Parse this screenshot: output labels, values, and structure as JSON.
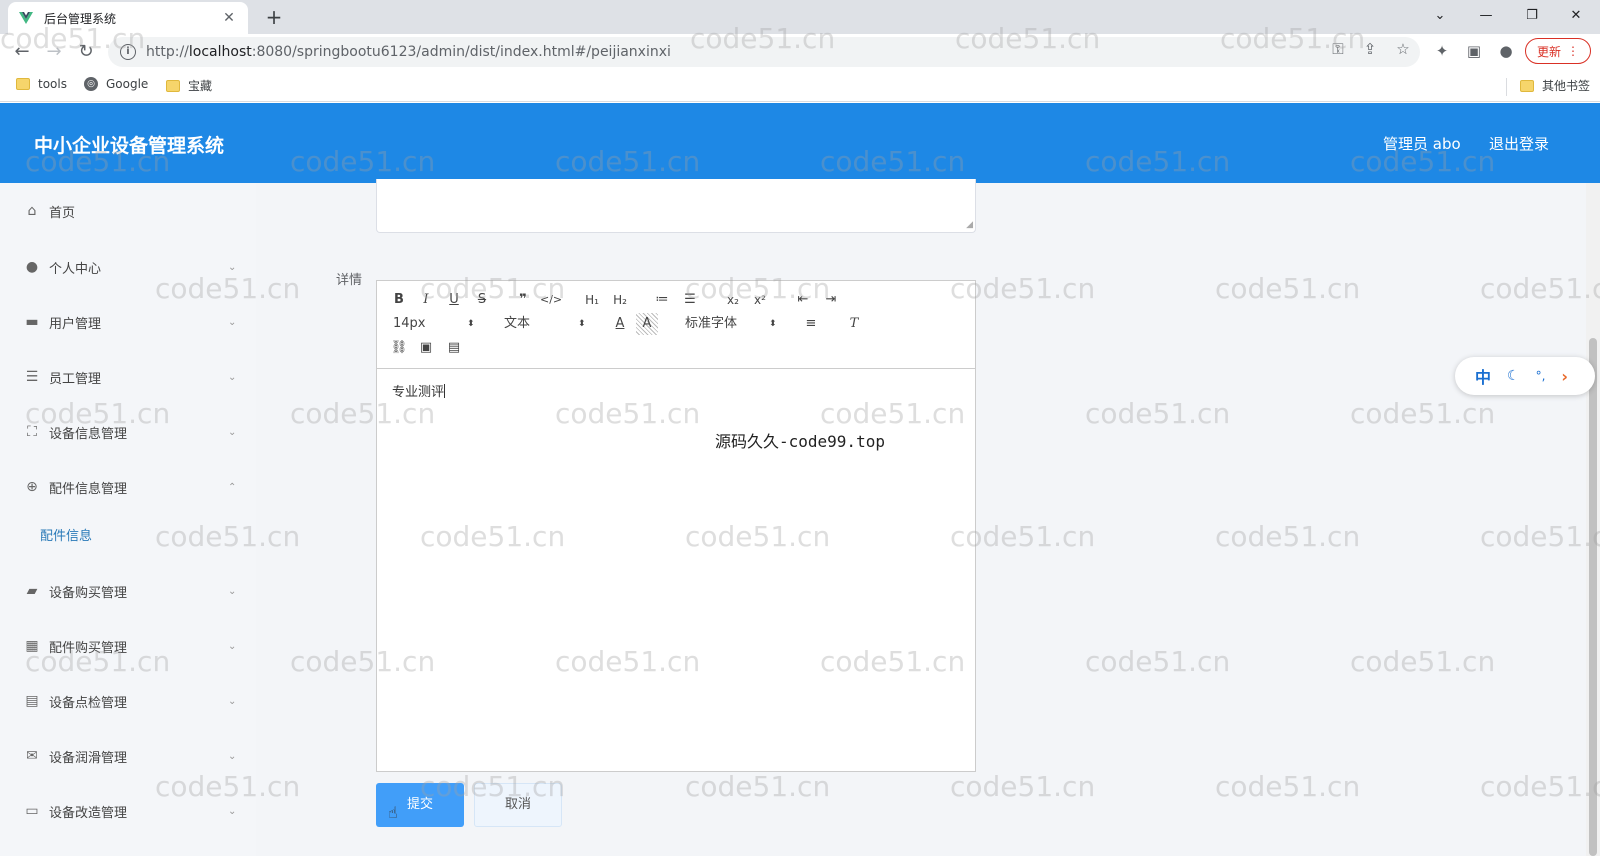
{
  "browser": {
    "tab_title": "后台管理系统",
    "tab_close": "✕",
    "new_tab": "+",
    "url_prefix": "http://",
    "url_host": "localhost",
    "url_rest": ":8080/springbootu6123/admin/dist/index.html#/peijianxinxi",
    "update_label": "更新",
    "bookmarks": [
      "tools",
      "Google",
      "宝藏"
    ],
    "other_bookmarks": "其他书签"
  },
  "app": {
    "title": "中小企业设备管理系统",
    "user": "管理员 abo",
    "logout": "退出登录"
  },
  "sidebar": {
    "items": [
      {
        "label": "首页",
        "icon": "home-icon"
      },
      {
        "label": "个人中心",
        "icon": "user-icon"
      },
      {
        "label": "用户管理",
        "icon": "briefcase-icon"
      },
      {
        "label": "员工管理",
        "icon": "list-icon"
      },
      {
        "label": "设备信息管理",
        "icon": "frame-icon"
      },
      {
        "label": "配件信息管理",
        "icon": "target-icon"
      },
      {
        "label": "设备购买管理",
        "icon": "ticket-icon"
      },
      {
        "label": "配件购买管理",
        "icon": "grid-icon"
      },
      {
        "label": "设备点检管理",
        "icon": "clipboard-icon"
      },
      {
        "label": "设备润滑管理",
        "icon": "mail-icon"
      },
      {
        "label": "设备改造管理",
        "icon": "card-icon"
      }
    ],
    "subitem": "配件信息"
  },
  "form": {
    "detail_label": "详情",
    "editor": {
      "font_size": "14px",
      "header": "文本",
      "font_family": "标准字体",
      "content": "专业测评"
    },
    "submit": "提交",
    "cancel": "取消"
  },
  "ime": {
    "lang": "中"
  },
  "watermark": "code51.cn",
  "center_mark": "源码久久-code99.top",
  "colors": {
    "header": "#1e88e5",
    "primary_button": "#419ef9",
    "submenu_active": "#2a7ab8"
  }
}
